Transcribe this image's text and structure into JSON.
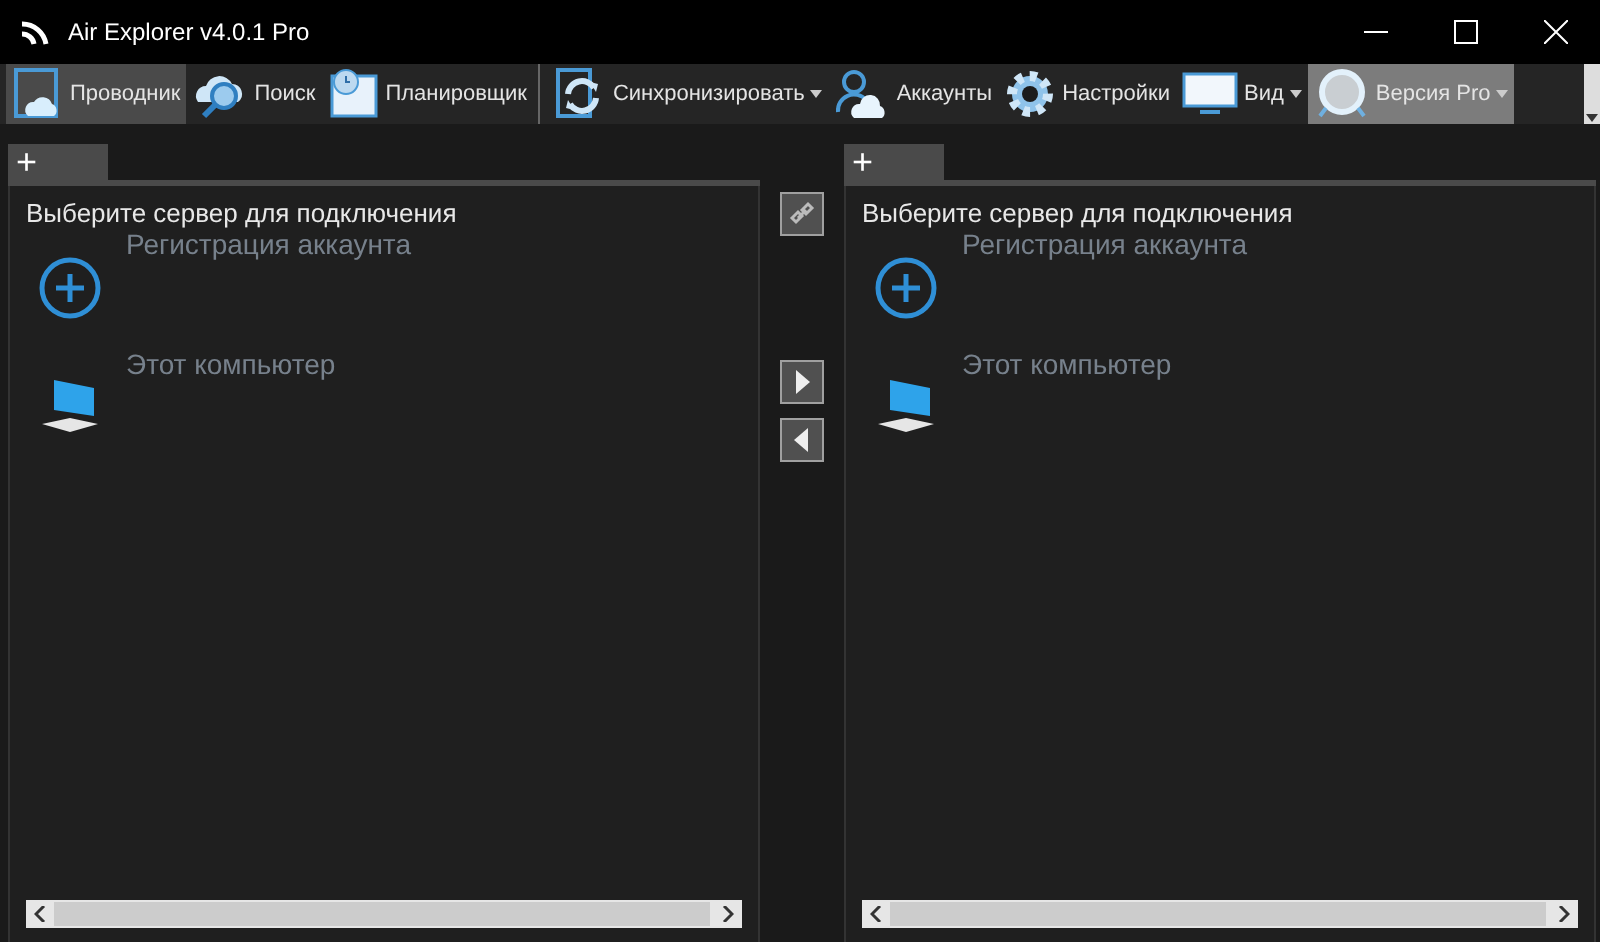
{
  "window": {
    "title": "Air Explorer v4.0.1 Pro"
  },
  "toolbar": [
    {
      "kind": "explorer",
      "label": "Проводник",
      "selected": true,
      "dropdown": false,
      "separator_after": false
    },
    {
      "kind": "search",
      "label": "Поиск",
      "selected": false,
      "dropdown": false,
      "separator_after": false
    },
    {
      "kind": "scheduler",
      "label": "Планировщик",
      "selected": false,
      "dropdown": false,
      "separator_after": true
    },
    {
      "kind": "sync",
      "label": "Синхронизировать",
      "selected": false,
      "dropdown": true,
      "separator_after": false
    },
    {
      "kind": "accounts",
      "label": "Аккаунты",
      "selected": false,
      "dropdown": false,
      "separator_after": false
    },
    {
      "kind": "settings",
      "label": "Настройки",
      "selected": false,
      "dropdown": false,
      "separator_after": false
    },
    {
      "kind": "view",
      "label": "Вид",
      "selected": false,
      "dropdown": true,
      "separator_after": false
    },
    {
      "kind": "pro",
      "label": "Версия Pro",
      "selected": false,
      "highlighted": true,
      "dropdown": true,
      "separator_after": false
    }
  ],
  "panes": [
    {
      "tab": "+",
      "heading": "Выберите сервер для подключения",
      "items": [
        {
          "kind": "add",
          "label": "Регистрация аккаунта"
        },
        {
          "kind": "computer",
          "label": "Этот компьютер"
        }
      ]
    },
    {
      "tab": "+",
      "heading": "Выберите сервер для подключения",
      "items": [
        {
          "kind": "add",
          "label": "Регистрация аккаунта"
        },
        {
          "kind": "computer",
          "label": "Этот компьютер"
        }
      ]
    }
  ]
}
